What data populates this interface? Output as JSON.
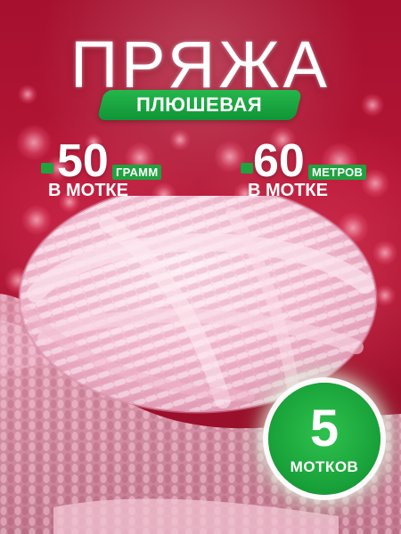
{
  "title": "ПРЯЖА",
  "subtitle": "ПЛЮШЕВАЯ",
  "stats": {
    "weight": {
      "value": "50",
      "unit": "ГРАММ",
      "label": "В МОТКЕ"
    },
    "length": {
      "value": "60",
      "unit": "МЕТРОВ",
      "label": "В МОТКЕ"
    }
  },
  "badge": {
    "value": "5",
    "label": "МОТКОВ"
  },
  "colors": {
    "background": "#a6112f",
    "accent_green": "#1fa23f",
    "yarn_pink": "#f6c6d8",
    "fabric_pink": "#d98fa6"
  }
}
